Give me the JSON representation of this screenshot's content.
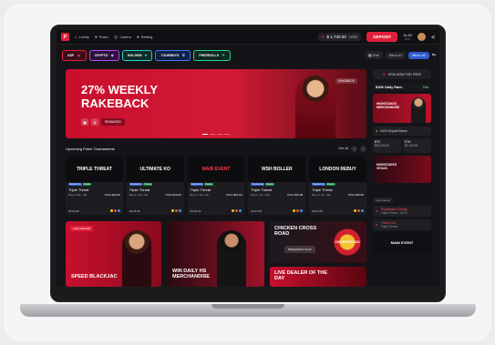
{
  "topbar": {
    "logo": "P",
    "nav": [
      {
        "label": "Lobby",
        "icon": "home-icon"
      },
      {
        "label": "Poker",
        "icon": "cards-icon"
      },
      {
        "label": "Casino",
        "icon": "casino-chip-icon"
      },
      {
        "label": "Betting",
        "icon": "ball-icon"
      }
    ],
    "balance": "$ 1,730.00",
    "currency": "USD",
    "deposit_label": "DEPOSIT",
    "time": "11:10",
    "time_sub": "UTC"
  },
  "categories": [
    {
      "label": "ASF",
      "bg": "#3a0e18",
      "border": "#e0203a"
    },
    {
      "label": "CRYPTO",
      "bg": "#2a123a",
      "border": "#b44bff"
    },
    {
      "label": "HOLDEM",
      "bg": "#0f2a2a",
      "border": "#2ad1c8"
    },
    {
      "label": "TOURNEYS",
      "bg": "#102040",
      "border": "#3a7bff"
    },
    {
      "label": "FREEROLLS",
      "bg": "#0f2a22",
      "border": "#2ad18a"
    }
  ],
  "controls": {
    "grid": "Grid",
    "micro1": "Micro #1",
    "micro2": "Micro #2"
  },
  "hero": {
    "title": "27% WEEKLY RAKEBACK",
    "button": "REWARDS",
    "tag": "RAKEBACK"
  },
  "tournaments": {
    "heading": "Upcoming Poker Tournaments",
    "see_all": "See all",
    "cards": [
      {
        "banner": "TRIPLE THREAT",
        "name": "Triple Threat",
        "buyin": "Buy in: $1 + $0",
        "prize": "Prize $10.00",
        "time": "00:23:45"
      },
      {
        "banner": "ULTIMATE KO",
        "name": "Triple Threat",
        "buyin": "Buy in: $1 + $0",
        "prize": "Prize $10.00",
        "time": "00:23:45"
      },
      {
        "banner": "MAIN EVENT",
        "name": "Triple Threat",
        "buyin": "Buy in: $1 + $0",
        "prize": "Prize $10.00",
        "time": "00:23:45"
      },
      {
        "banner": "WSH BOLLER",
        "name": "Triple Threat",
        "buyin": "Buy in: $1 + $0",
        "prize": "Prize $10.00",
        "time": "00:23:45"
      },
      {
        "banner": "LONDON REBUY",
        "name": "Triple Threat",
        "buyin": "Buy in: $1 + $0",
        "prize": "Prize $10.00",
        "time": "00:23:45"
      }
    ],
    "badge1": "Registering",
    "badge2": "Freeze"
  },
  "tiles": {
    "live_dealer_tag": "LIVE DEALER",
    "speed_title": "SPEED BLACKJAC",
    "merch_title": "WIN DAILY HS MERCHANDISE",
    "chicken_title": "CHICKEN CROSS ROAD",
    "chicken_btn": "PRAGMATIC PLAY",
    "chicken_logo": "CHICKEN ROAD",
    "ldotd_title": "LIVE DEALER OF THE DAY"
  },
  "right": {
    "spin": "SPIN NOW FOR FREE",
    "race_title": "$10K Daily Race",
    "race_val": "24h",
    "banner1": "HIGHSTAKES MERCHANDISE",
    "bonus": "100% Deposit Bonus",
    "crypto": [
      {
        "sym": "BTC",
        "val": "$81,000.00"
      },
      {
        "sym": "ETH",
        "val": "$2,130.65"
      }
    ],
    "banner2": "HIGHSTAKES VEGAS",
    "last_games": "Last Games",
    "li1": "Registration Closing",
    "li1_sub": "Triple Threat · 00:23",
    "li2": "Freeze Out",
    "li2_sub": "Triple Threat",
    "main_event": "MAIN EVENT"
  }
}
